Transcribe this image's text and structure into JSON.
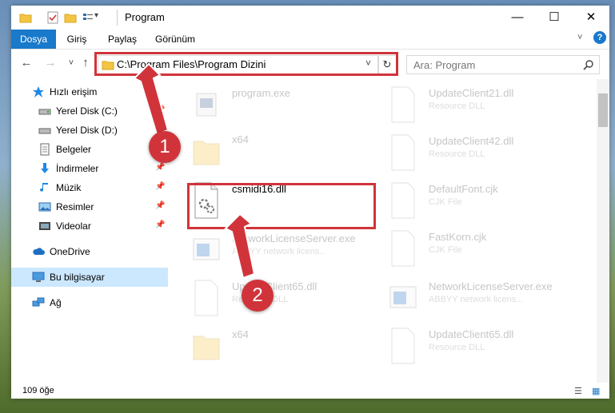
{
  "window": {
    "title": "Program",
    "controls": {
      "minimize": "—",
      "maximize": "☐",
      "close": "✕"
    }
  },
  "ribbon": {
    "tabs": [
      {
        "label": "Dosya",
        "active": true
      },
      {
        "label": "Giriş"
      },
      {
        "label": "Paylaş"
      },
      {
        "label": "Görünüm"
      }
    ]
  },
  "nav": {
    "back": "←",
    "forward": "→",
    "recent": "˅",
    "up": "↑",
    "address": "C:\\Program Files\\Program Dizini",
    "address_dropdown": "˅",
    "refresh": "↻",
    "search_placeholder": "Ara: Program",
    "search_icon": "search-icon"
  },
  "sidebar": {
    "items": [
      {
        "label": "Hızlı erişim",
        "icon": "star-icon"
      },
      {
        "label": "Yerel Disk (C:)",
        "icon": "drive-icon"
      },
      {
        "label": "Yerel Disk (D:)",
        "icon": "drive-icon"
      },
      {
        "label": "Belgeler",
        "icon": "document-icon"
      },
      {
        "label": "İndirmeler",
        "icon": "download-icon"
      },
      {
        "label": "Müzik",
        "icon": "music-icon"
      },
      {
        "label": "Resimler",
        "icon": "pictures-icon"
      },
      {
        "label": "Videolar",
        "icon": "video-icon"
      },
      {
        "label": "OneDrive",
        "icon": "cloud-icon"
      },
      {
        "label": "Bu bilgisayar",
        "icon": "computer-icon"
      },
      {
        "label": "Ağ",
        "icon": "network-icon"
      }
    ]
  },
  "files": {
    "program_exe": {
      "name": "program.exe",
      "type": ""
    },
    "x64_1": {
      "name": "x64",
      "type": ""
    },
    "csmidi": {
      "name": "csmidi16.dll",
      "type": ""
    },
    "networklicense_1": {
      "name": "NetworkLicenseServer.exe",
      "type": "ABBYY network licens..."
    },
    "updateclient65_1": {
      "name": "UpdateClient65.dll",
      "type": "Resource DLL"
    },
    "x64_2": {
      "name": "x64",
      "type": ""
    },
    "updateclient21": {
      "name": "UpdateClient21.dll",
      "type": "Resource DLL"
    },
    "updateclient42": {
      "name": "UpdateClient42.dll",
      "type": "Resource DLL"
    },
    "defaultfont": {
      "name": "DefaultFont.cjk",
      "type": "CJK File"
    },
    "fastkorn": {
      "name": "FastKorn.cjk",
      "type": "CJK File"
    },
    "networklicense_2": {
      "name": "NetworkLicenseServer.exe",
      "type": "ABBYY network licens..."
    },
    "updateclient65_2": {
      "name": "UpdateClient65.dll",
      "type": "Resource DLL"
    }
  },
  "status": {
    "count": "109 öğe"
  },
  "callouts": {
    "one": "1",
    "two": "2"
  },
  "colors": {
    "accent": "#1979ca",
    "highlight": "#d0343a",
    "selection": "#cce8ff"
  }
}
